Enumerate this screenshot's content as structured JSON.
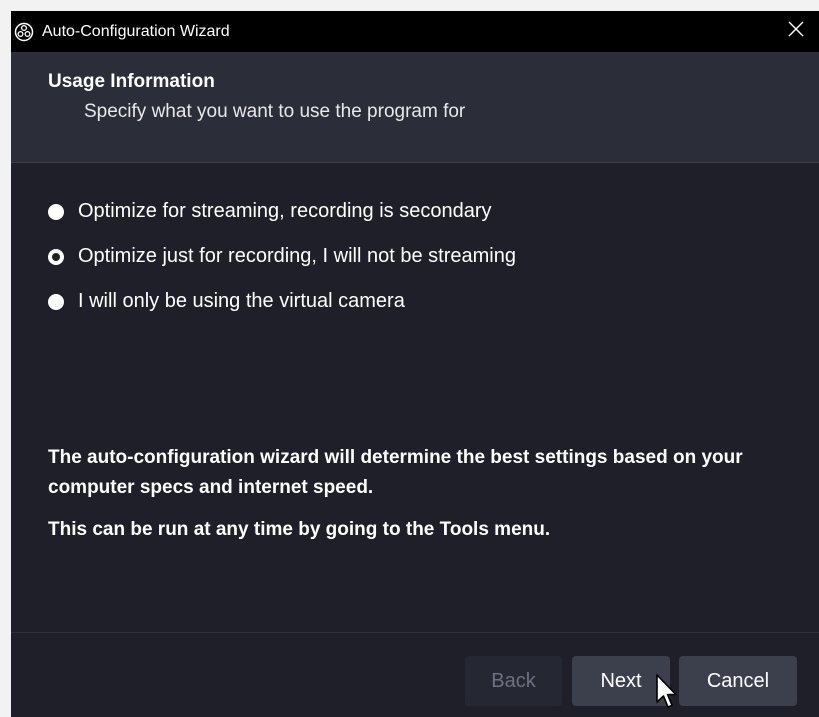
{
  "window": {
    "title": "Auto-Configuration Wizard"
  },
  "header": {
    "heading": "Usage Information",
    "subheading": "Specify what you want to use the program for"
  },
  "options": {
    "items": [
      {
        "label": "Optimize for streaming, recording is secondary",
        "selected": false
      },
      {
        "label": "Optimize just for recording, I will not be streaming",
        "selected": true
      },
      {
        "label": "I will only be using the virtual camera",
        "selected": false
      }
    ]
  },
  "info": {
    "line1": "The auto-configuration wizard will determine the best settings based on your computer specs and internet speed.",
    "line2": "This can be run at any time by going to the Tools menu."
  },
  "buttons": {
    "back": "Back",
    "next": "Next",
    "cancel": "Cancel"
  },
  "icons": {
    "app": "obs-logo-icon",
    "close": "close-icon",
    "cursor": "mouse-pointer-icon"
  },
  "colors": {
    "titlebar": "#000000",
    "header": "#2b2e38",
    "body": "#1e1f29",
    "button": "#3c404c",
    "button_disabled": "#252832"
  }
}
